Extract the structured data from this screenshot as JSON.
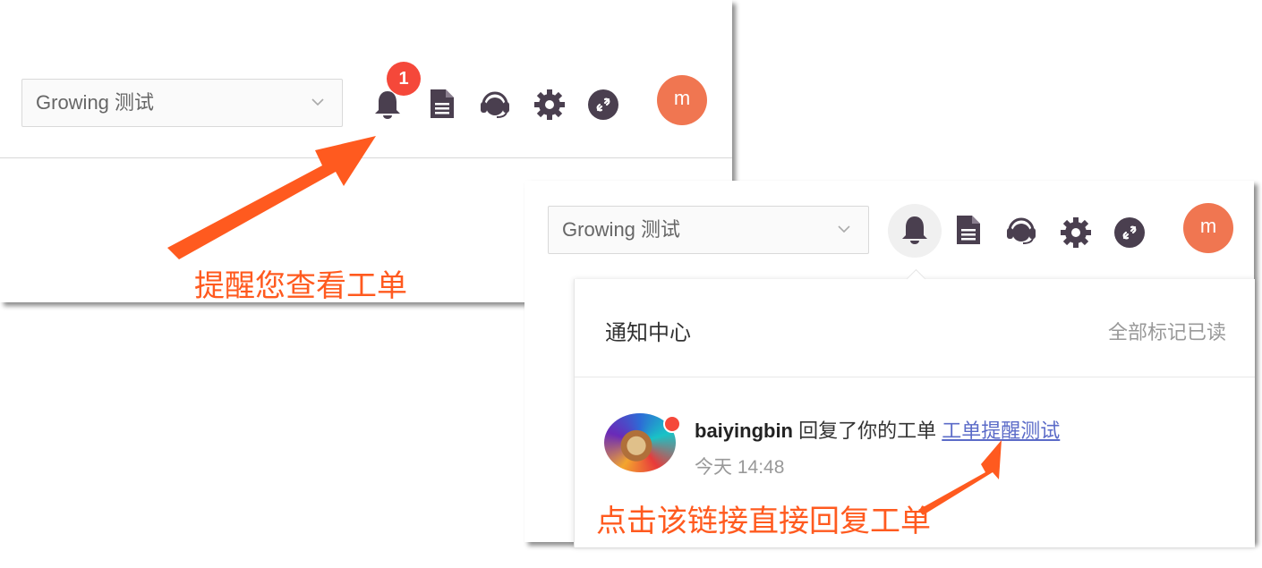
{
  "colors": {
    "accent": "#ff5a1f",
    "badge": "#f5483a",
    "avatar": "#f07651",
    "icon": "#4a3f4f",
    "link": "#5b6bc8"
  },
  "panel_top": {
    "select_value": "Growing 测试",
    "badge_count": "1",
    "avatar_letter": "m",
    "icons": [
      "bell-icon",
      "document-icon",
      "headset-icon",
      "gear-icon",
      "link-icon"
    ]
  },
  "panel_bottom": {
    "select_value": "Growing 测试",
    "avatar_letter": "m",
    "notifications": {
      "title": "通知中心",
      "mark_all_read": "全部标记已读",
      "items": [
        {
          "user": "baiyingbin",
          "action": "回复了你的工单",
          "link_text": "工单提醒测试",
          "time": "今天 14:48"
        }
      ]
    }
  },
  "annotations": {
    "remind": "提醒您查看工单",
    "click_link": "点击该链接直接回复工单"
  }
}
